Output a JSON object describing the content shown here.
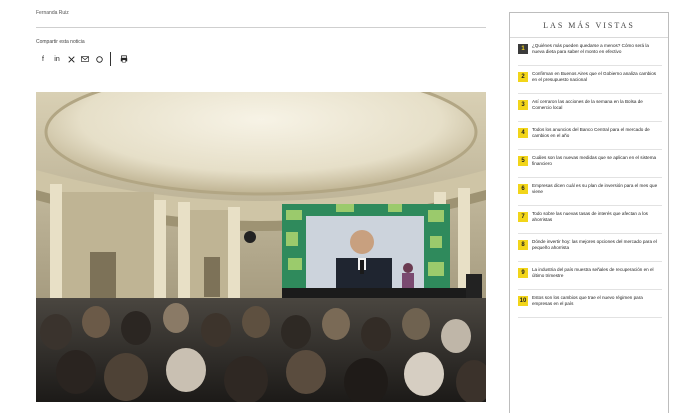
{
  "article": {
    "byline": "Fernanda Ruiz",
    "share_label": "Compartir esta noticia",
    "share_icons": [
      "facebook-icon",
      "linkedin-icon",
      "twitter-icon",
      "mail-icon",
      "whatsapp-icon",
      "print-icon"
    ]
  },
  "photo": {
    "description": "Event in a domed hall with an audience facing a large screen showing a speaker"
  },
  "sidebar": {
    "title": "LAS MÁS VISTAS",
    "items": [
      {
        "num": "1",
        "text": "¿Quiénes más pueden quedarse a menos? Cómo será la nueva dieta para saber el monto en efectivo"
      },
      {
        "num": "2",
        "text": "Confirman en Buenos Aires que el Gobierno analiza cambios en el presupuesto nacional"
      },
      {
        "num": "3",
        "text": "Así cerraron las acciones de la semana en la Bolsa de Comercio local"
      },
      {
        "num": "4",
        "text": "Todos los anuncios del Banco Central para el mercado de cambios en el año"
      },
      {
        "num": "5",
        "text": "Cuáles son las nuevas medidas que se aplican en el sistema financiero"
      },
      {
        "num": "6",
        "text": "Empresas dicen cuál es su plan de inversión para el mes que viene"
      },
      {
        "num": "7",
        "text": "Todo sobre las nuevas tasas de interés que afectan a los ahorristas"
      },
      {
        "num": "8",
        "text": "Dónde invertir hoy: las mejores opciones del mercado para el pequeño ahorrista"
      },
      {
        "num": "9",
        "text": "La industria del país muestra señales de recuperación en el último trimestre"
      },
      {
        "num": "10",
        "text": "Estos son los cambios que trae el nuevo régimen para empresas en el país"
      }
    ]
  }
}
